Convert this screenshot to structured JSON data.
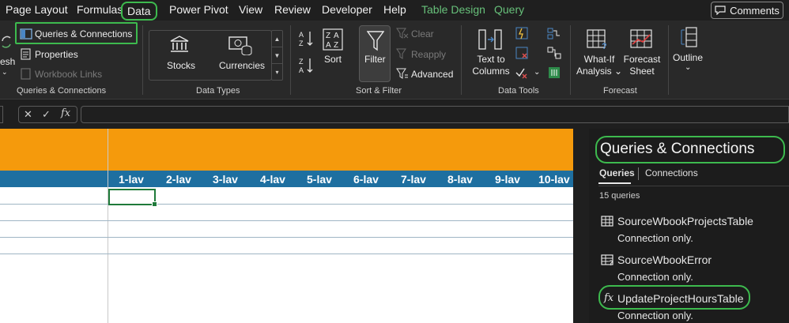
{
  "menu": {
    "items": [
      "Page Layout",
      "Formulas",
      "Data",
      "Power Pivot",
      "View",
      "Review",
      "Developer",
      "Help",
      "Table Design",
      "Query"
    ],
    "active": "Data",
    "comments_label": "Comments"
  },
  "ribbon": {
    "refresh_partial": "esh",
    "queries_connections_button": "Queries & Connections",
    "properties": "Properties",
    "workbook_links": "Workbook Links",
    "group_queries": "Queries & Connections",
    "stocks": "Stocks",
    "currencies": "Currencies",
    "group_datatypes": "Data Types",
    "sort": "Sort",
    "filter": "Filter",
    "clear": "Clear",
    "reapply": "Reapply",
    "advanced": "Advanced",
    "group_sortfilter": "Sort & Filter",
    "text_to_columns_1": "Text to",
    "text_to_columns_2": "Columns",
    "group_datatools": "Data Tools",
    "whatif_1": "What-If",
    "whatif_2": "Analysis",
    "forecast_sheet_1": "Forecast",
    "forecast_sheet_2": "Sheet",
    "group_forecast": "Forecast",
    "outline": "Outline"
  },
  "formula_bar": {
    "fx_label": "fx",
    "value": ""
  },
  "sheet": {
    "headers": [
      "1-lav",
      "2-lav",
      "3-lav",
      "4-lav",
      "5-lav",
      "6-lav",
      "7-lav",
      "8-lav",
      "9-lav",
      "10-lav"
    ],
    "colors": {
      "banner": "#f59a0c",
      "header": "#1e6fa0"
    }
  },
  "pane": {
    "title": "Queries & Connections",
    "tab_queries": "Queries",
    "tab_connections": "Connections",
    "count": "15 queries",
    "queries": [
      {
        "name": "SourceWbookProjectsTable",
        "status": "Connection only.",
        "icon": "table-icon"
      },
      {
        "name": "SourceWbookError",
        "status": "Connection only.",
        "icon": "table-error-icon"
      },
      {
        "name": "UpdateProjectHoursTable",
        "status": "Connection only.",
        "icon": "function-icon"
      }
    ]
  },
  "accent_color": "#3dba4e"
}
